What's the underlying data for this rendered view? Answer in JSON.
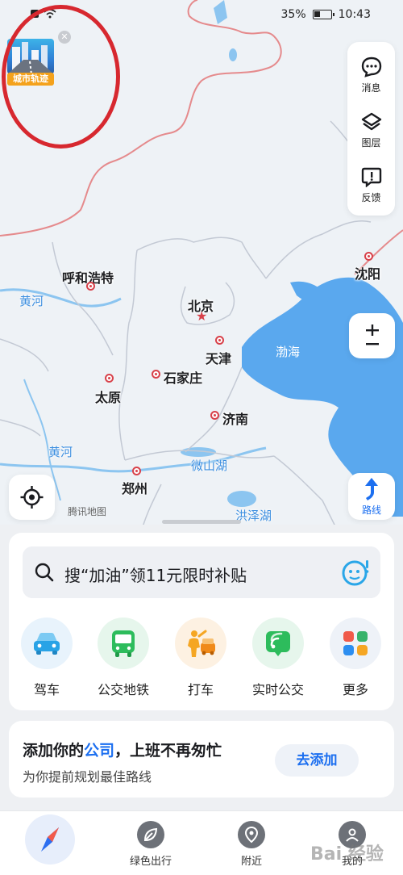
{
  "status_bar": {
    "battery": "35%",
    "time": "10:43"
  },
  "badge": {
    "label": "城市轨迹"
  },
  "toolbar": {
    "messages": "消息",
    "layers": "图层",
    "feedback": "反馈"
  },
  "map": {
    "cities": {
      "huhehaote": "呼和浩特",
      "beijing": "北京",
      "tianjin": "天津",
      "shijiazhuang": "石家庄",
      "taiyuan": "太原",
      "jinan": "济南",
      "zhengzhou": "郑州",
      "shenyang": "沈阳"
    },
    "water": {
      "huanghe_north": "黄河",
      "huanghe_south": "黄河",
      "bohai": "渤海",
      "weishanhu": "微山湖",
      "hongzehu": "洪泽湖"
    },
    "provider": "腾讯地图",
    "route_label": "路线",
    "colors": {
      "land": "#eef2f6",
      "sea": "#5aa8ee",
      "border": "#e58a8c",
      "river": "#8cc5f0"
    }
  },
  "search": {
    "placeholder": "搜“加油”领11元限时补贴"
  },
  "quick_actions": [
    {
      "label": "驾车",
      "icon": "car-icon"
    },
    {
      "label": "公交地铁",
      "icon": "bus-icon"
    },
    {
      "label": "打车",
      "icon": "taxi-icon"
    },
    {
      "label": "实时公交",
      "icon": "realtime-bus-icon"
    },
    {
      "label": "更多",
      "icon": "more-grid-icon"
    }
  ],
  "commute_card": {
    "title_prefix": "添加你的",
    "title_highlight": "公司",
    "title_suffix": "，上班不再匆忙",
    "subtitle": "为你提前规划最佳路线",
    "button": "去添加"
  },
  "tabbar": [
    {
      "label": ""
    },
    {
      "label": "绿色出行"
    },
    {
      "label": "附近"
    },
    {
      "label": "我的"
    }
  ],
  "watermark": "Bai 经验"
}
